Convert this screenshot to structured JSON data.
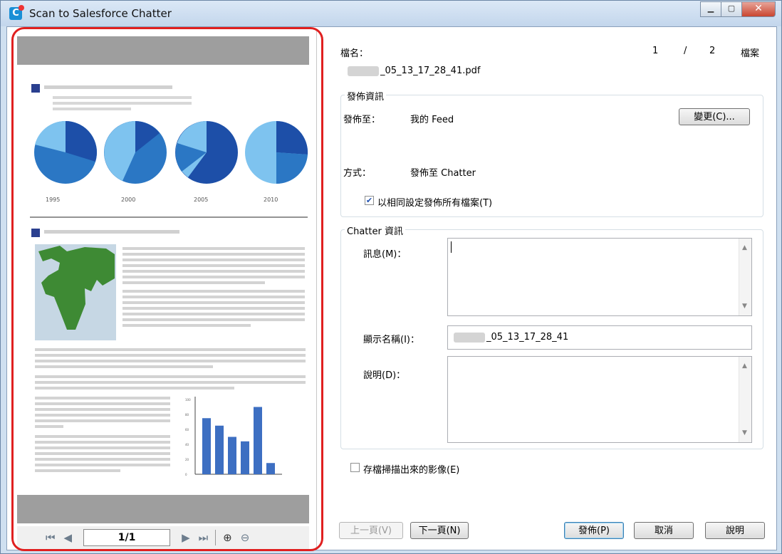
{
  "window": {
    "title": "Scan to Salesforce Chatter"
  },
  "preview": {
    "page_indicator": "1/1",
    "years": [
      "1995",
      "2000",
      "2005",
      "2010"
    ],
    "bar_ticks": [
      "100",
      "80",
      "60",
      "40",
      "20",
      "0"
    ],
    "bar_values": [
      75,
      65,
      50,
      44,
      90,
      15
    ]
  },
  "file": {
    "label": "檔名：",
    "name_suffix": "_05_13_17_28_41.pdf",
    "index": "1",
    "slash": "/",
    "total": "2",
    "unit": "檔案"
  },
  "publish_info": {
    "title": "發佈資訊",
    "target_label": "發佈至：",
    "target_value": "我的 Feed",
    "change_button": "變更(C)...",
    "method_label": "方式：",
    "method_value": "發佈至 Chatter",
    "same_settings_label": "以相同設定發佈所有檔案(T)",
    "same_settings_checked": true
  },
  "chatter_info": {
    "title": "Chatter 資訊",
    "message_label": "訊息(M)：",
    "message_value": "",
    "display_name_label": "顯示名稱(I)：",
    "display_name_suffix": "_05_13_17_28_41",
    "description_label": "說明(D)：",
    "description_value": ""
  },
  "save_image": {
    "label": "存檔掃描出來的影像(E)",
    "checked": false
  },
  "buttons": {
    "prev": "上一頁(V)",
    "next": "下一頁(N)",
    "publish": "發佈(P)",
    "cancel": "取消",
    "help": "說明"
  }
}
